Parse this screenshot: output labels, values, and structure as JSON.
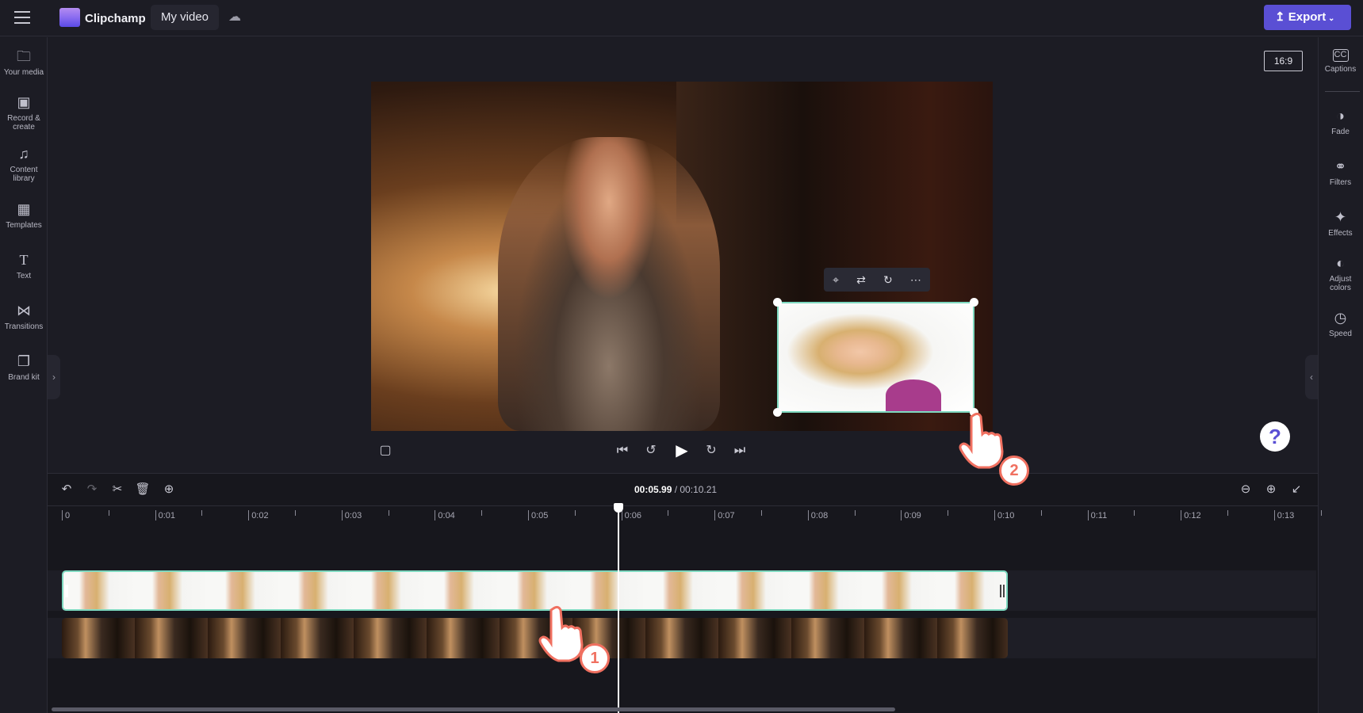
{
  "header": {
    "app_name": "Clipchamp",
    "project_title": "My video",
    "export_label": "Export",
    "export_color": "#5a4fd4",
    "cloud_icon": "cloud-off-icon"
  },
  "left_sidebar": {
    "items": [
      {
        "label": "Your media",
        "icon": "folder-icon"
      },
      {
        "label": "Record & create",
        "icon": "camera-icon"
      },
      {
        "label": "Content library",
        "icon": "library-icon"
      },
      {
        "label": "Templates",
        "icon": "templates-icon"
      },
      {
        "label": "Text",
        "icon": "text-icon"
      },
      {
        "label": "Transitions",
        "icon": "transitions-icon"
      },
      {
        "label": "Brand kit",
        "icon": "brand-kit-icon"
      }
    ]
  },
  "right_sidebar": {
    "items": [
      {
        "label": "Captions",
        "icon": "cc-icon"
      },
      {
        "label": "Fade",
        "icon": "fade-icon"
      },
      {
        "label": "Filters",
        "icon": "filters-icon"
      },
      {
        "label": "Effects",
        "icon": "effects-icon"
      },
      {
        "label": "Adjust colors",
        "icon": "adjust-colors-icon"
      },
      {
        "label": "Speed",
        "icon": "speed-icon"
      }
    ]
  },
  "preview": {
    "aspect_ratio": "16:9",
    "help": "?"
  },
  "timeline": {
    "current_time": "00:05.99",
    "total_time": "/ 00:10.21",
    "ruler_labels": [
      "0",
      "0:01",
      "0:02",
      "0:03",
      "0:04",
      "0:05",
      "0:06",
      "0:07",
      "0:08",
      "0:09",
      "0:10",
      "0:11",
      "0:12",
      "0:13"
    ],
    "selected_clip_color": "#7ed9c0"
  },
  "annotations": {
    "step1": "1",
    "step2": "2"
  }
}
